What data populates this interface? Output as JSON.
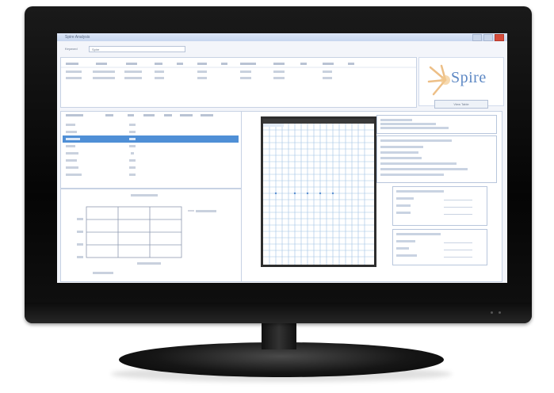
{
  "window": {
    "title": "Spire Analysis"
  },
  "filter": {
    "label": "Keyword",
    "value": "Spire"
  },
  "logo": {
    "text": "Spire",
    "button_label": "View Table"
  },
  "colors": {
    "accent": "#4f8fd6",
    "bezel": "#0a0a0a",
    "brand": "#5d88c4"
  },
  "icons": {
    "close": "close-icon",
    "minimize": "minimize-icon",
    "maximize": "maximize-icon"
  }
}
